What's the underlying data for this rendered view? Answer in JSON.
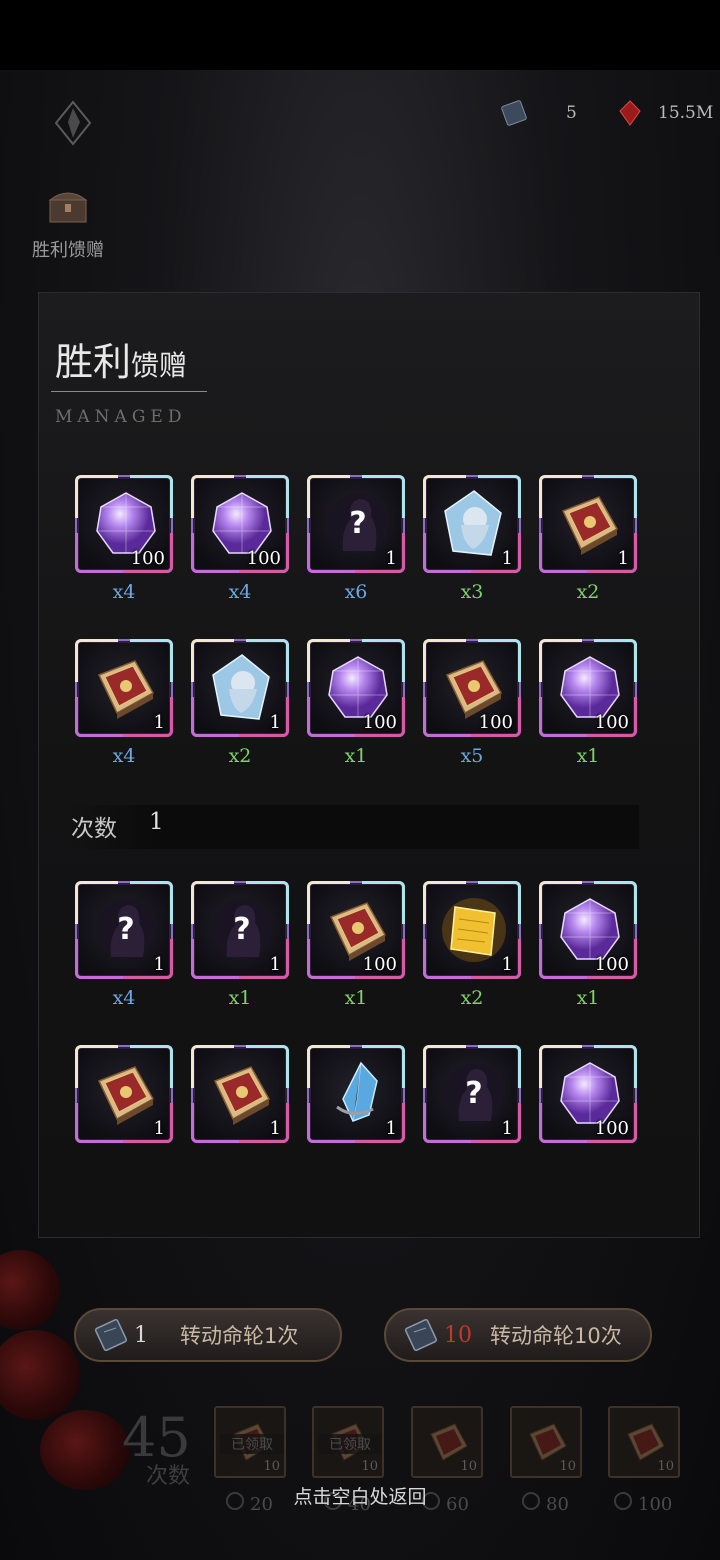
{
  "resources": [
    {
      "icon": "ticket-icon",
      "value": "5"
    },
    {
      "icon": "red-crystal-icon",
      "value": "15.5M"
    }
  ],
  "side_button": {
    "label": "胜利馈赠"
  },
  "panel": {
    "title_big": "胜利",
    "title_small": "馈赠",
    "subtitle": "MANAGED",
    "rewards_row1": [
      {
        "icon": "purple-gem-icon",
        "count": "100",
        "mult": "x4",
        "color": "blue"
      },
      {
        "icon": "purple-gem-icon",
        "count": "100",
        "mult": "x4",
        "color": "blue"
      },
      {
        "icon": "mystery-silhouette-icon",
        "count": "1",
        "mult": "x6",
        "color": "blue"
      },
      {
        "icon": "ice-crystal-portrait-icon",
        "count": "1",
        "mult": "x3",
        "color": "green"
      },
      {
        "icon": "ornate-book-icon",
        "count": "1",
        "mult": "x2",
        "color": "green"
      }
    ],
    "rewards_row2": [
      {
        "icon": "ornate-book-icon",
        "count": "1",
        "mult": "x4",
        "color": "blue"
      },
      {
        "icon": "ice-crystal-portrait-icon",
        "count": "1",
        "mult": "x2",
        "color": "green"
      },
      {
        "icon": "purple-gem-icon",
        "count": "100",
        "mult": "x1",
        "color": "green"
      },
      {
        "icon": "ornate-book-icon",
        "count": "100",
        "mult": "x5",
        "color": "blue"
      },
      {
        "icon": "purple-gem-icon",
        "count": "100",
        "mult": "x1",
        "color": "green"
      }
    ],
    "count_label": "次数",
    "count_value": "1",
    "rewards_row3": [
      {
        "icon": "mystery-silhouette-icon",
        "count": "1",
        "mult": "x4",
        "color": "blue"
      },
      {
        "icon": "mystery-silhouette-icon",
        "count": "1",
        "mult": "x1",
        "color": "green"
      },
      {
        "icon": "ornate-book-icon",
        "count": "100",
        "mult": "x1",
        "color": "green"
      },
      {
        "icon": "golden-scroll-icon",
        "count": "1",
        "mult": "x2",
        "color": "green"
      },
      {
        "icon": "purple-gem-icon",
        "count": "100",
        "mult": "x1",
        "color": "green"
      }
    ],
    "rewards_row4": [
      {
        "icon": "ornate-book-icon",
        "count": "1",
        "mult": "",
        "color": "blue"
      },
      {
        "icon": "ornate-book-icon",
        "count": "1",
        "mult": "",
        "color": "blue"
      },
      {
        "icon": "blue-crystal-shard-icon",
        "count": "1",
        "mult": "",
        "color": "green"
      },
      {
        "icon": "mystery-silhouette-icon",
        "count": "1",
        "mult": "",
        "color": "blue"
      },
      {
        "icon": "purple-gem-icon",
        "count": "100",
        "mult": "",
        "color": "blue"
      }
    ]
  },
  "spin_buttons": [
    {
      "cost": "1",
      "label": "转动命轮1次",
      "cost_color": "#d8d8d8"
    },
    {
      "cost": "10",
      "label": "转动命轮10次",
      "cost_color": "#c0392b"
    }
  ],
  "progress": {
    "count": "45",
    "label": "次数",
    "slots": [
      {
        "tag": "已领取",
        "n": "10",
        "milestone": "20"
      },
      {
        "tag": "已领取",
        "n": "10",
        "milestone": "40"
      },
      {
        "tag": "",
        "n": "10",
        "milestone": "60"
      },
      {
        "tag": "",
        "n": "10",
        "milestone": "80"
      },
      {
        "tag": "",
        "n": "10",
        "milestone": "100"
      }
    ]
  },
  "return_hint": "点击空白处返回"
}
